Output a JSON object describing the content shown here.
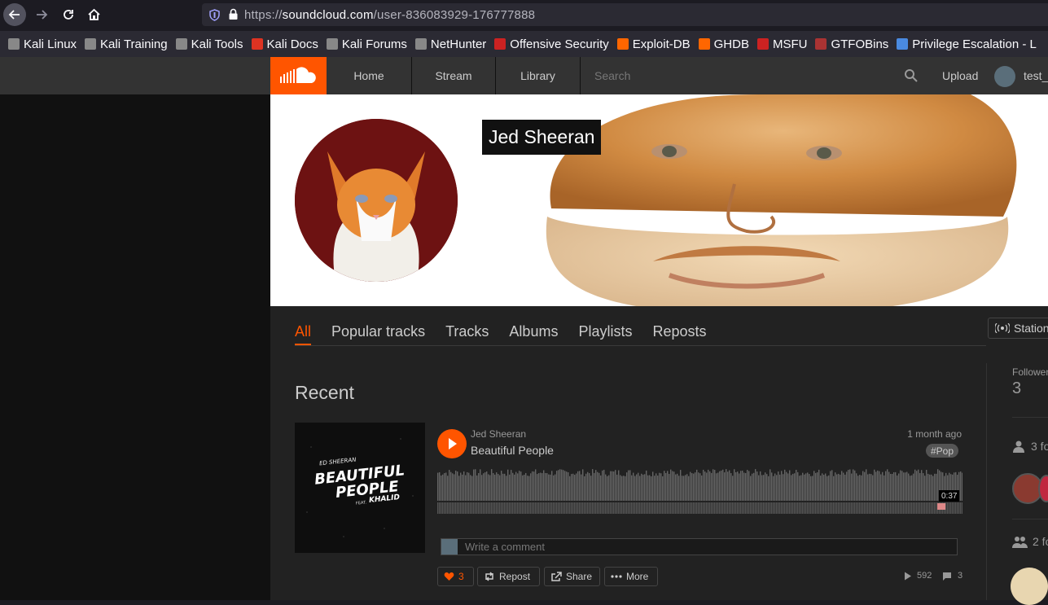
{
  "browser": {
    "url_prefix": "https://",
    "url_domain": "soundcloud.com",
    "url_path": "/user-836083929-176777888"
  },
  "bookmarks": [
    {
      "label": "Kali Linux",
      "icon": "kali-dragon-icon"
    },
    {
      "label": "Kali Training",
      "icon": "kali-dragon-icon"
    },
    {
      "label": "Kali Tools",
      "icon": "kali-dragon-icon"
    },
    {
      "label": "Kali Docs",
      "icon": "kali-docs-icon"
    },
    {
      "label": "Kali Forums",
      "icon": "kali-dragon-icon"
    },
    {
      "label": "NetHunter",
      "icon": "kali-dragon-icon"
    },
    {
      "label": "Offensive Security",
      "icon": "offsec-icon"
    },
    {
      "label": "Exploit-DB",
      "icon": "exploitdb-icon"
    },
    {
      "label": "GHDB",
      "icon": "exploitdb-icon"
    },
    {
      "label": "MSFU",
      "icon": "offsec-icon"
    },
    {
      "label": "GTFOBins",
      "icon": "gtfobins-icon"
    },
    {
      "label": "Privilege Escalation - L",
      "icon": "stack-icon"
    }
  ],
  "header": {
    "home": "Home",
    "stream": "Stream",
    "library": "Library",
    "search_placeholder": "Search",
    "upload": "Upload",
    "username": "test_"
  },
  "profile": {
    "name": "Jed Sheeran"
  },
  "tabs": [
    {
      "label": "All",
      "active": true
    },
    {
      "label": "Popular tracks"
    },
    {
      "label": "Tracks"
    },
    {
      "label": "Albums"
    },
    {
      "label": "Playlists"
    },
    {
      "label": "Reposts"
    }
  ],
  "station": "Station",
  "recent": {
    "title": "Recent",
    "track": {
      "artist": "Jed Sheeran",
      "title": "Beautiful People",
      "posted": "1 month ago",
      "tag": "#Pop",
      "duration": "0:37",
      "artwork_line1": "ED SHEERAN",
      "artwork_line2": "BEAUTIFUL",
      "artwork_line3": "PEOPLE",
      "artwork_feat": "FEAT.",
      "artwork_line4": "KHALID",
      "likes": "3",
      "repost": "Repost",
      "share": "Share",
      "more": "More",
      "plays": "592",
      "comments": "3"
    },
    "comment_placeholder": "Write a comment"
  },
  "sidebar": {
    "followers_label": "Followers",
    "followers_count": "3",
    "followers_row": "3 fo",
    "following_row": "2 fo"
  },
  "colors": {
    "accent": "#ff5500",
    "like": "#ff5500"
  }
}
